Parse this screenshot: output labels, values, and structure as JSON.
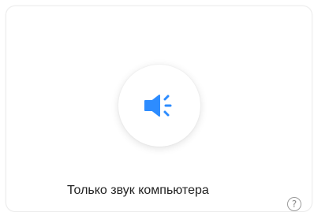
{
  "option": {
    "label": "Только звук компьютера",
    "icon": "speaker-icon",
    "accent_color": "#2d8cff",
    "selected": false
  },
  "help": {
    "icon": "help-icon",
    "glyph": "?"
  }
}
